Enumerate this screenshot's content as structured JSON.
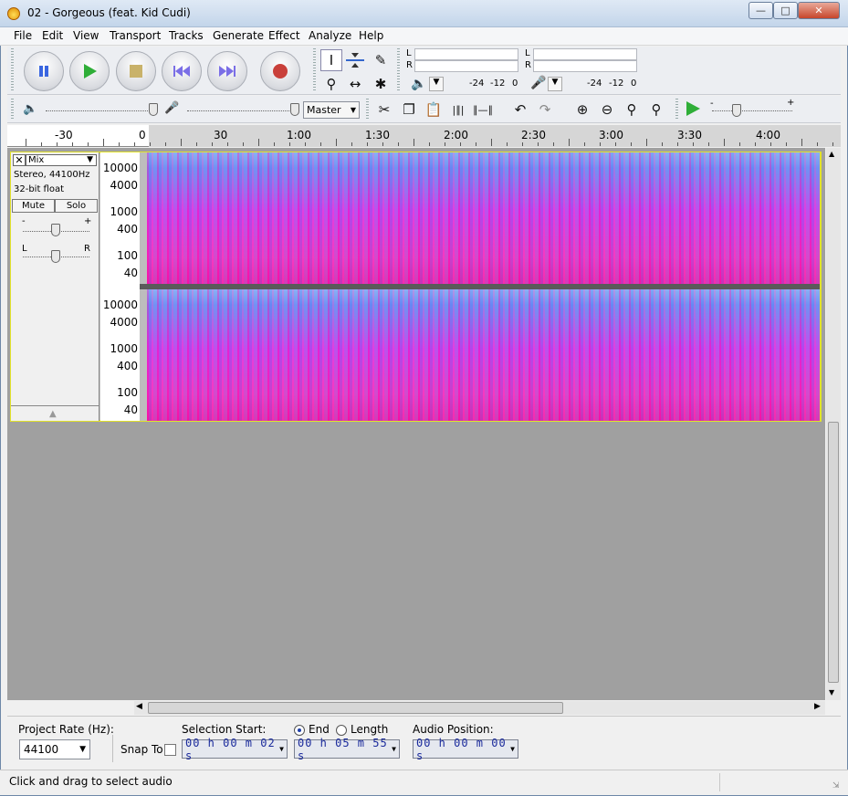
{
  "window": {
    "title": "02 - Gorgeous (feat. Kid Cudi)"
  },
  "menu": [
    "File",
    "Edit",
    "View",
    "Transport",
    "Tracks",
    "Generate",
    "Effect",
    "Analyze",
    "Help"
  ],
  "meters": {
    "left": "L",
    "right": "R",
    "play_ticks": [
      "-24",
      "-12",
      "0"
    ],
    "rec_ticks": [
      "-24",
      "-12",
      "0"
    ]
  },
  "mixer": {
    "input_source": "Master"
  },
  "ruler": {
    "labels": [
      "-30",
      "0",
      "30",
      "1:00",
      "1:30",
      "2:00",
      "2:30",
      "3:00",
      "3:30",
      "4:00"
    ]
  },
  "track": {
    "name": "Mix",
    "info1": "Stereo, 44100Hz",
    "info2": "32-bit float",
    "mute": "Mute",
    "solo": "Solo",
    "gain_minus": "-",
    "gain_plus": "+",
    "pan_left": "L",
    "pan_right": "R",
    "scale": [
      "10000",
      "4000",
      "1000",
      "400",
      "100",
      "40"
    ]
  },
  "bottom": {
    "project_rate_label": "Project Rate (Hz):",
    "project_rate": "44100",
    "snap_label": "Snap To",
    "selection_start_label": "Selection Start:",
    "end_label": "End",
    "length_label": "Length",
    "audio_position_label": "Audio Position:",
    "sel_start": "00 h 00 m 02 s",
    "sel_end": "00 h 05 m 55 s",
    "audio_pos": "00 h 00 m 00 s"
  },
  "status": "Click and drag to select audio"
}
